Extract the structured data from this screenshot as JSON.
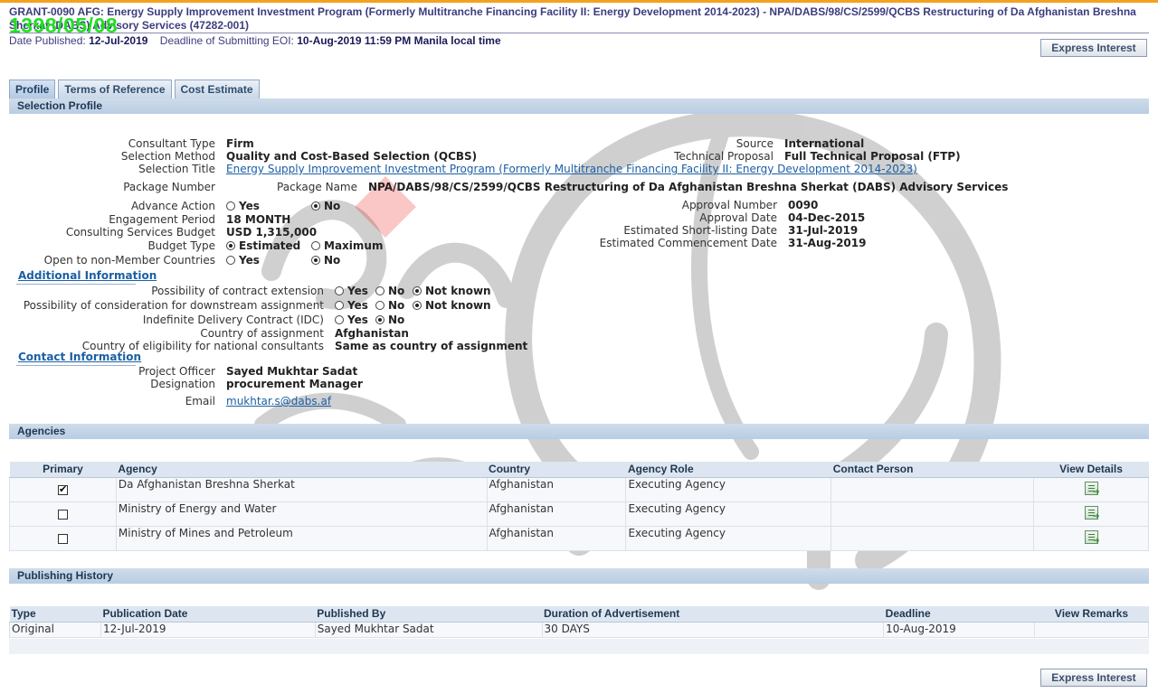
{
  "header": {
    "title": "GRANT-0090 AFG: Energy Supply Improvement Investment Program (Formerly Multitranche Financing Facility II: Energy Development 2014-2023) - NPA/DABS/98/CS/2599/QCBS Restructuring of Da Afghanistan Breshna Sherkat (DABS) Advisory Services (47282-001)",
    "stamp": "1398/05/08",
    "date_published_label": "Date Published:",
    "date_published": "12-Jul-2019",
    "deadline_label": "Deadline of Submitting EOI:",
    "deadline": "10-Aug-2019 11:59 PM Manila local time",
    "express_interest": "Express Interest"
  },
  "tabs": [
    "Profile",
    "Terms of Reference",
    "Cost Estimate"
  ],
  "selection_profile": {
    "section_title": "Selection Profile",
    "consultant_type_label": "Consultant Type",
    "consultant_type": "Firm",
    "selection_method_label": "Selection Method",
    "selection_method": "Quality and Cost-Based Selection (QCBS)",
    "selection_title_label": "Selection Title",
    "selection_title": "Energy Supply Improvement Investment Program (Formerly Multitranche Financing Facility II: Energy Development 2014-2023)",
    "source_label": "Source",
    "source": "International",
    "technical_proposal_label": "Technical Proposal",
    "technical_proposal": "Full Technical Proposal (FTP)",
    "package_number_label": "Package Number",
    "package_name_label": "Package Name",
    "package_name": "NPA/DABS/98/CS/2599/QCBS Restructuring of Da Afghanistan Breshna Sherkat (DABS) Advisory Services",
    "advance_action_label": "Advance Action",
    "yes": "Yes",
    "no": "No",
    "engagement_period_label": "Engagement Period",
    "engagement_period": "18 MONTH",
    "budget_label": "Consulting Services Budget",
    "budget": "USD 1,315,000",
    "budget_type_label": "Budget Type",
    "estimated": "Estimated",
    "maximum": "Maximum",
    "non_member_label": "Open to non-Member Countries",
    "approval_number_label": "Approval Number",
    "approval_number": "0090",
    "approval_date_label": "Approval Date",
    "approval_date": "04-Dec-2015",
    "shortlisting_label": "Estimated Short-listing Date",
    "shortlisting_date": "31-Jul-2019",
    "commencement_label": "Estimated Commencement Date",
    "commencement_date": "31-Aug-2019"
  },
  "additional_info": {
    "title": "Additional Information",
    "extension_label": "Possibility of contract extension",
    "downstream_label": "Possibility of consideration for downstream assignment",
    "idc_label": "Indefinite Delivery Contract (IDC)",
    "yes": "Yes",
    "no": "No",
    "not_known": "Not known",
    "country_label": "Country of assignment",
    "country": "Afghanistan",
    "eligibility_label": "Country of eligibility for national consultants",
    "eligibility": "Same as country of assignment"
  },
  "contact": {
    "title": "Contact Information",
    "officer_label": "Project Officer",
    "officer": "Sayed Mukhtar Sadat",
    "designation_label": "Designation",
    "designation": "procurement Manager",
    "email_label": "Email",
    "email": "mukhtar.s@dabs.af"
  },
  "agencies": {
    "section_title": "Agencies",
    "columns": [
      "Primary",
      "Agency",
      "Country",
      "Agency Role",
      "Contact Person",
      "View Details"
    ],
    "rows": [
      {
        "agency": "Da Afghanistan Breshna Sherkat",
        "country": "Afghanistan",
        "role": "Executing Agency",
        "contact": ""
      },
      {
        "agency": "Ministry of Energy and Water",
        "country": "Afghanistan",
        "role": "Executing Agency",
        "contact": ""
      },
      {
        "agency": "Ministry of Mines and Petroleum",
        "country": "Afghanistan",
        "role": "Executing Agency",
        "contact": ""
      }
    ]
  },
  "publishing": {
    "section_title": "Publishing History",
    "columns": [
      "Type",
      "Publication Date",
      "Published By",
      "Duration of Advertisement",
      "Deadline",
      "View Remarks"
    ],
    "rows": [
      {
        "type": "Original",
        "date": "12-Jul-2019",
        "by": "Sayed Mukhtar Sadat",
        "duration": "30 DAYS",
        "deadline": "10-Aug-2019",
        "remarks": ""
      }
    ]
  }
}
